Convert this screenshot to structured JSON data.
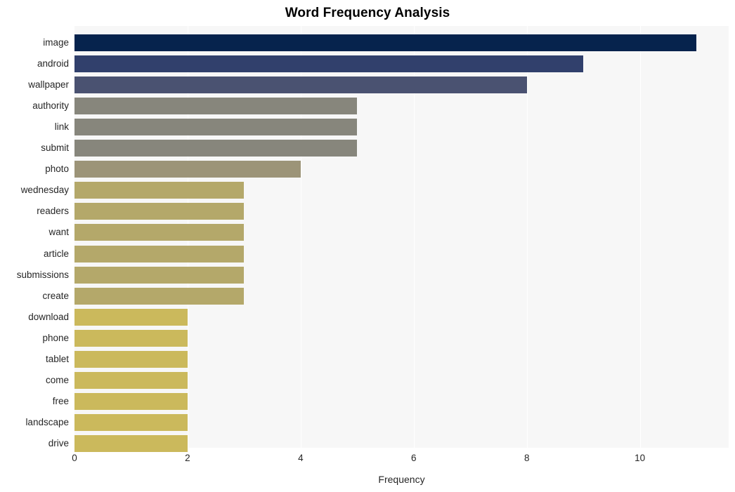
{
  "chart_data": {
    "type": "bar",
    "orientation": "horizontal",
    "title": "Word Frequency Analysis",
    "xlabel": "Frequency",
    "ylabel": "",
    "categories": [
      "image",
      "android",
      "wallpaper",
      "authority",
      "link",
      "submit",
      "photo",
      "wednesday",
      "readers",
      "want",
      "article",
      "submissions",
      "create",
      "download",
      "phone",
      "tablet",
      "come",
      "free",
      "landscape",
      "drive"
    ],
    "values": [
      11,
      9,
      8,
      5,
      5,
      5,
      4,
      3,
      3,
      3,
      3,
      3,
      3,
      2,
      2,
      2,
      2,
      2,
      2,
      2
    ],
    "bar_colors": [
      "#06234d",
      "#31406c",
      "#4a5271",
      "#87867c",
      "#87867c",
      "#87867c",
      "#9c9478",
      "#b4a86a",
      "#b4a86a",
      "#b4a86a",
      "#b4a86a",
      "#b4a86a",
      "#b4a86a",
      "#cbb95c",
      "#cbb95c",
      "#cbb95c",
      "#cbb95c",
      "#cbb95c",
      "#cbb95c",
      "#cbb95c"
    ],
    "xlim": [
      0,
      11.57
    ],
    "ylim_categories": 20,
    "x_ticks": [
      0,
      2,
      4,
      6,
      8,
      10
    ],
    "x_tick_labels": [
      "0",
      "2",
      "4",
      "6",
      "8",
      "10"
    ],
    "grid": "vertical-white",
    "legend": "none",
    "plot_background": "#f7f7f7",
    "figure_background": "#ffffff",
    "text_color": "#262626",
    "title_color": "#000000"
  }
}
